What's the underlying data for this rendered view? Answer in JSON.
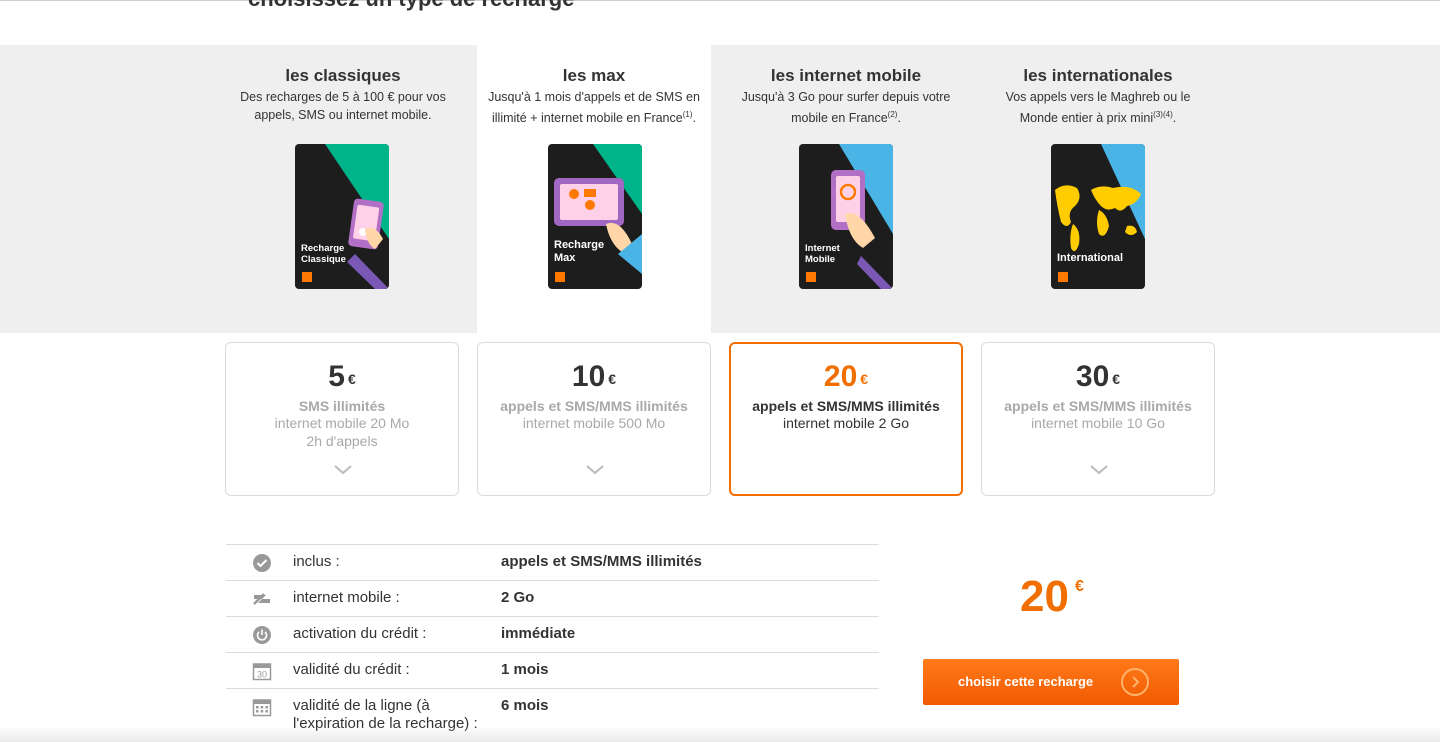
{
  "page": {
    "heading": "choisissez un type de recharge"
  },
  "categories": [
    {
      "title": "les classiques",
      "desc": "Des recharges de 5 à 100 € pour vos appels, SMS ou internet mobile.",
      "card_label_1": "Recharge",
      "card_label_2": "Classique",
      "card_accent": "#00b48a"
    },
    {
      "title": "les max",
      "desc": "Jusqu'à 1 mois d'appels et de SMS en illimité + internet mobile en France",
      "desc_sup": "(1)",
      "desc_end": ".",
      "card_label_1": "Recharge",
      "card_label_2": "Max",
      "card_accent": "#00b48a"
    },
    {
      "title": "les internet mobile",
      "desc": "Jusqu'à 3 Go pour surfer depuis votre mobile en France",
      "desc_sup": "(2)",
      "desc_end": ".",
      "card_label_1": "Internet",
      "card_label_2": "Mobile",
      "card_accent": "#4bb4e6"
    },
    {
      "title": "les internationales",
      "desc": "Vos appels vers le Maghreb ou le Monde entier à prix mini",
      "desc_sup": "(3)(4)",
      "desc_end": ".",
      "card_label_1": "International",
      "card_accent": "#4bb4e6"
    }
  ],
  "offers": [
    {
      "price": "5",
      "currency": "€",
      "line1": "SMS illimités",
      "line2": "internet mobile 20 Mo",
      "line3": "2h d'appels",
      "selected": false
    },
    {
      "price": "10",
      "currency": "€",
      "line1": "appels et SMS/MMS illimités",
      "line2": "internet mobile 500 Mo",
      "selected": false
    },
    {
      "price": "20",
      "currency": "€",
      "line1": "appels et SMS/MMS illimités",
      "line2": "internet mobile 2 Go",
      "selected": true
    },
    {
      "price": "30",
      "currency": "€",
      "line1": "appels et SMS/MMS illimités",
      "line2": "internet mobile 10 Go",
      "selected": false
    }
  ],
  "details": [
    {
      "icon": "check-circle-icon",
      "label": "inclus :",
      "value": "appels et SMS/MMS illimités"
    },
    {
      "icon": "internet-icon",
      "label": "internet mobile :",
      "value": "2 Go"
    },
    {
      "icon": "power-icon",
      "label": "activation du crédit :",
      "value": "immédiate"
    },
    {
      "icon": "calendar-30-icon",
      "label": "validité du crédit :",
      "value": "1 mois",
      "icon_text": "30"
    },
    {
      "icon": "calendar-icon",
      "label_1": "validité de la ligne (à",
      "label_2": "l'expiration de la recharge) :",
      "value": "6 mois"
    }
  ],
  "summary": {
    "price": "20",
    "currency": "€"
  },
  "cta": {
    "label": "choisir cette recharge"
  },
  "colors": {
    "brand": "#f16e00",
    "band": "#efefef"
  }
}
